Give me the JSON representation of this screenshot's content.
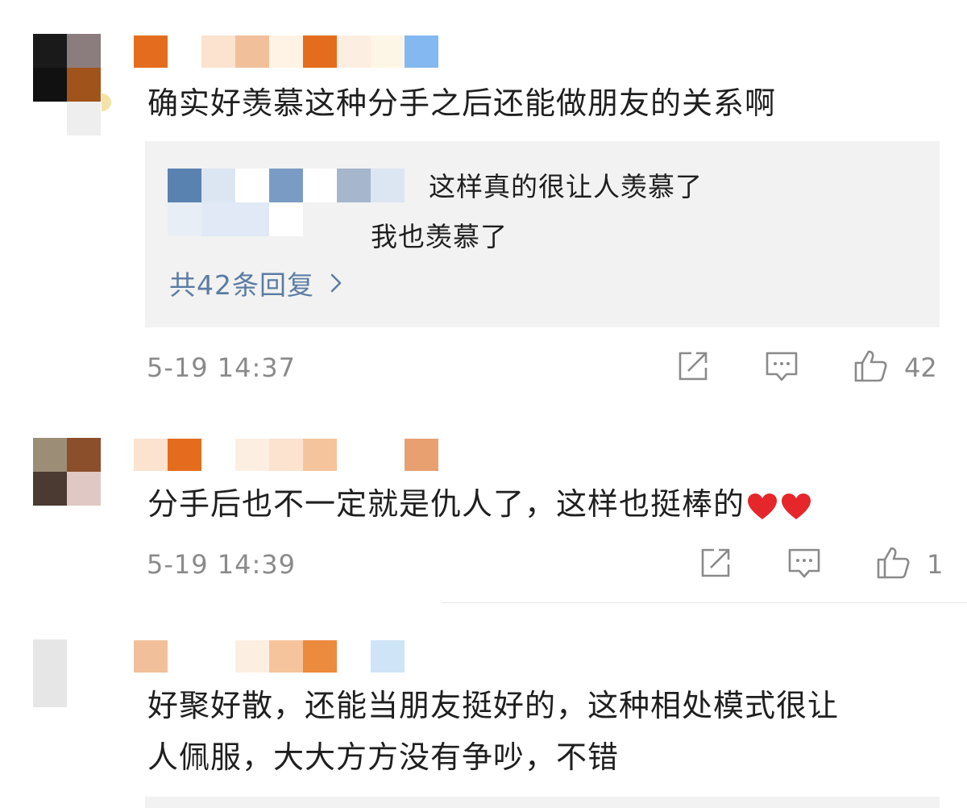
{
  "comments": [
    {
      "text": "确实好羡慕这种分手之后还能做朋友的关系啊",
      "avatar_colors": [
        "#1a1a1a",
        "#8b7d7d",
        "#111111",
        "#a0541c"
      ],
      "username_colors": [
        "#e46d1d",
        "#ffffff",
        "#fbe3cf",
        "#f1c09a",
        "#fff3e5",
        "#e46d1d",
        "#fdeee2",
        "#fdf6e6",
        "#84b8f0"
      ],
      "replies": {
        "line1": "这样真的很让人羡慕了",
        "line2": "我也羡慕了",
        "avatar1_colors": [
          "#5a82b0",
          "#dce6f3",
          "#ffffff",
          "#7a9cc4",
          "#ffffff",
          "#a6b6cc",
          "#dce6f3",
          "#e8eef6",
          "#e0e9f5",
          "#e0e9f5",
          "#ffffff"
        ],
        "count_label": "共42条回复",
        "chevron": "chevron-right-icon"
      },
      "timestamp": "5-19 14:37",
      "likes": "42"
    },
    {
      "text": "分手后也不一定就是仇人了，这样也挺棒的",
      "emoji": [
        "heart-icon",
        "heart-icon"
      ],
      "avatar_colors": [
        "#9c8d77",
        "#8b4f2b",
        "#4a3a32",
        "#e0c8c4"
      ],
      "username_colors": [
        "#fbe3cf",
        "#e46d1d",
        "#ffffff",
        "#fdeee2",
        "#fbe3cf",
        "#f5c49c",
        "#ffffff",
        "#ffffff",
        "#e8a070"
      ],
      "timestamp": "5-19 14:39",
      "likes": "1"
    },
    {
      "text_line1": "好聚好散，还能当朋友挺好的，这种相处模式很让",
      "text_line2": "人佩服，大大方方没有争吵，不错",
      "avatar_colors": [
        "#e6e6e6",
        "#ffffff",
        "#e6e6e6",
        "#ffffff"
      ],
      "username_colors": [
        "#f1c09a",
        "#ffffff",
        "#ffffff",
        "#fdeee2",
        "#f5c49c",
        "#ec8a3e",
        "#ffffff",
        "#d0e4f7"
      ]
    }
  ],
  "icons": {
    "share": "share-icon",
    "comment": "comment-icon",
    "like": "thumbs-up-icon"
  },
  "colors": {
    "link": "#5b7ca3",
    "muted": "#8a8a8a",
    "reply_bg": "#f2f2f2",
    "heart": "#e5262a"
  }
}
